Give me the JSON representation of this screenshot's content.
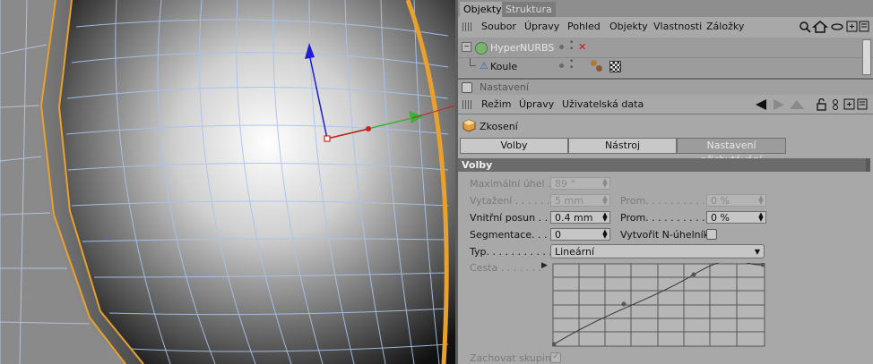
{
  "tabs": [
    "Objekty",
    "Struktura"
  ],
  "menu_main": [
    "Soubor",
    "Úpravy",
    "Pohled",
    "Objekty",
    "Vlastnosti",
    "Záložky"
  ],
  "objects": [
    {
      "name": "HyperNURBS",
      "dimmed": true
    },
    {
      "name": "Koule",
      "dimmed": false
    }
  ],
  "attributes_title": "Nastavení",
  "menu_attr": [
    "Režim",
    "Úpravy",
    "Uživatelská data"
  ],
  "tool_name": "Zkosení",
  "tool_tabs": [
    "Volby",
    "Nástroj",
    "Nastavení přichytávání"
  ],
  "section_title": "Volby",
  "fields": {
    "max_angle_label": "Maximální úhel . .",
    "max_angle_value": "89 °",
    "extrude_label": "Vytažení . . . . . . .",
    "extrude_value": "5 mm",
    "extrude_var_label": "Prom. . . . . . . . . . .",
    "extrude_var_value": "0 %",
    "inner_label": "Vnitřní posun . . . .",
    "inner_value": "0.4 mm",
    "inner_var_label": "Prom. . . . . . . . . . .",
    "inner_var_value": "0 %",
    "seg_label": "Segmentace. . . . .",
    "seg_value": "0",
    "ngon_label": "Vytvořit N-úhelníky",
    "type_label": "Typ. . . . . . . . . . . .",
    "type_value": "Lineární",
    "path_label": "Cesta . . . . . . .",
    "keep_groups_label": "Zachovat skupiny"
  },
  "colors": {
    "panel": "#a8a8a8",
    "section": "#6b6b6b",
    "mesh_edge": "#e8a12c",
    "wire": "#a8c4ee"
  }
}
